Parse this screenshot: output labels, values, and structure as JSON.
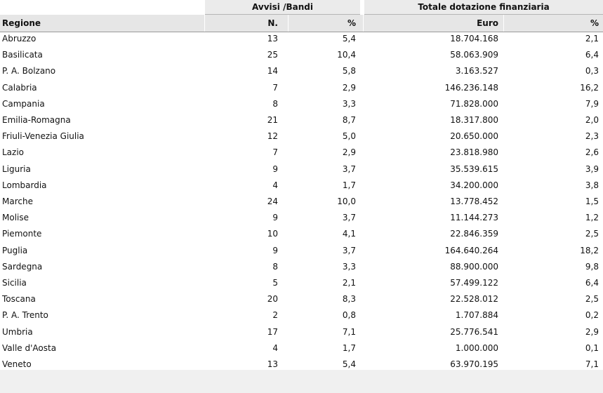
{
  "table": {
    "group_headers": {
      "avvisi": "Avvisi /Bandi",
      "dotazione": "Totale dotazione finanziaria"
    },
    "column_headers": {
      "regione": "Regione",
      "n": "N.",
      "pct1": "%",
      "euro": "Euro",
      "pct2": "%"
    },
    "rows": [
      {
        "regione": "Abruzzo",
        "n": "13",
        "pct1": "5,4",
        "euro": "18.704.168",
        "pct2": "2,1"
      },
      {
        "regione": "Basilicata",
        "n": "25",
        "pct1": "10,4",
        "euro": "58.063.909",
        "pct2": "6,4"
      },
      {
        "regione": "P. A. Bolzano",
        "n": "14",
        "pct1": "5,8",
        "euro": "3.163.527",
        "pct2": "0,3"
      },
      {
        "regione": "Calabria",
        "n": "7",
        "pct1": "2,9",
        "euro": "146.236.148",
        "pct2": "16,2"
      },
      {
        "regione": "Campania",
        "n": "8",
        "pct1": "3,3",
        "euro": "71.828.000",
        "pct2": "7,9"
      },
      {
        "regione": "Emilia-Romagna",
        "n": "21",
        "pct1": "8,7",
        "euro": "18.317.800",
        "pct2": "2,0"
      },
      {
        "regione": "Friuli-Venezia Giulia",
        "n": "12",
        "pct1": "5,0",
        "euro": "20.650.000",
        "pct2": "2,3"
      },
      {
        "regione": "Lazio",
        "n": "7",
        "pct1": "2,9",
        "euro": "23.818.980",
        "pct2": "2,6"
      },
      {
        "regione": "Liguria",
        "n": "9",
        "pct1": "3,7",
        "euro": "35.539.615",
        "pct2": "3,9"
      },
      {
        "regione": "Lombardia",
        "n": "4",
        "pct1": "1,7",
        "euro": "34.200.000",
        "pct2": "3,8"
      },
      {
        "regione": "Marche",
        "n": "24",
        "pct1": "10,0",
        "euro": "13.778.452",
        "pct2": "1,5"
      },
      {
        "regione": "Molise",
        "n": "9",
        "pct1": "3,7",
        "euro": "11.144.273",
        "pct2": "1,2"
      },
      {
        "regione": "Piemonte",
        "n": "10",
        "pct1": "4,1",
        "euro": "22.846.359",
        "pct2": "2,5"
      },
      {
        "regione": "Puglia",
        "n": "9",
        "pct1": "3,7",
        "euro": "164.640.264",
        "pct2": "18,2"
      },
      {
        "regione": "Sardegna",
        "n": "8",
        "pct1": "3,3",
        "euro": "88.900.000",
        "pct2": "9,8"
      },
      {
        "regione": "Sicilia",
        "n": "5",
        "pct1": "2,1",
        "euro": "57.499.122",
        "pct2": "6,4"
      },
      {
        "regione": "Toscana",
        "n": "20",
        "pct1": "8,3",
        "euro": "22.528.012",
        "pct2": "2,5"
      },
      {
        "regione": "P. A. Trento",
        "n": "2",
        "pct1": "0,8",
        "euro": "1.707.884",
        "pct2": "0,2"
      },
      {
        "regione": "Umbria",
        "n": "17",
        "pct1": "7,1",
        "euro": "25.776.541",
        "pct2": "2,9"
      },
      {
        "regione": "Valle d'Aosta",
        "n": "4",
        "pct1": "1,7",
        "euro": "1.000.000",
        "pct2": "0,1"
      },
      {
        "regione": "Veneto",
        "n": "13",
        "pct1": "5,4",
        "euro": "63.970.195",
        "pct2": "7,1"
      }
    ]
  }
}
